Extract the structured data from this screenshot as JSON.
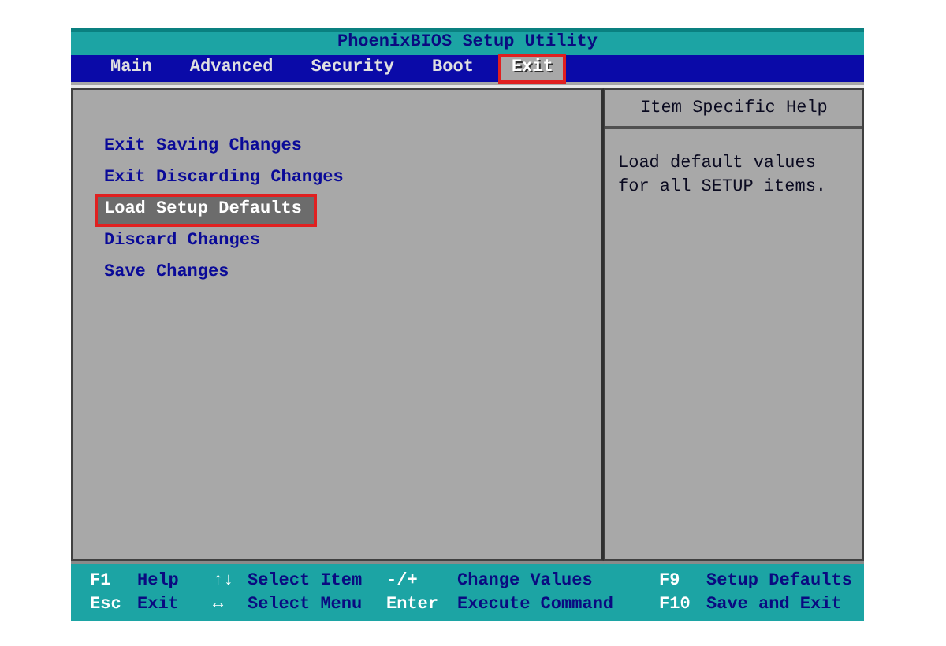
{
  "title": "PhoenixBIOS Setup Utility",
  "tabs": [
    {
      "label": "Main",
      "selected": false,
      "outlined": false
    },
    {
      "label": "Advanced",
      "selected": false,
      "outlined": false
    },
    {
      "label": "Security",
      "selected": false,
      "outlined": false
    },
    {
      "label": "Boot",
      "selected": false,
      "outlined": false
    },
    {
      "label": "Exit",
      "selected": true,
      "outlined": true
    }
  ],
  "menu_items": [
    {
      "label": "Exit Saving Changes",
      "selected": false,
      "outlined": false
    },
    {
      "label": "Exit Discarding Changes",
      "selected": false,
      "outlined": false
    },
    {
      "label": "Load Setup Defaults",
      "selected": true,
      "outlined": true
    },
    {
      "label": "Discard Changes",
      "selected": false,
      "outlined": false
    },
    {
      "label": "Save Changes",
      "selected": false,
      "outlined": false
    }
  ],
  "help": {
    "heading": "Item Specific Help",
    "text": "Load default values for all SETUP items."
  },
  "footer": [
    [
      {
        "key": "F1",
        "action": "Help"
      },
      {
        "key": "↑↓",
        "action": "Select Item"
      },
      {
        "key": "-/+",
        "action": "Change Values"
      },
      {
        "key": "F9",
        "action": "Setup Defaults"
      }
    ],
    [
      {
        "key": "Esc",
        "action": "Exit"
      },
      {
        "key": "↔",
        "action": "Select Menu"
      },
      {
        "key": "Enter",
        "action": "Execute Command"
      },
      {
        "key": "F10",
        "action": "Save and Exit"
      }
    ]
  ]
}
